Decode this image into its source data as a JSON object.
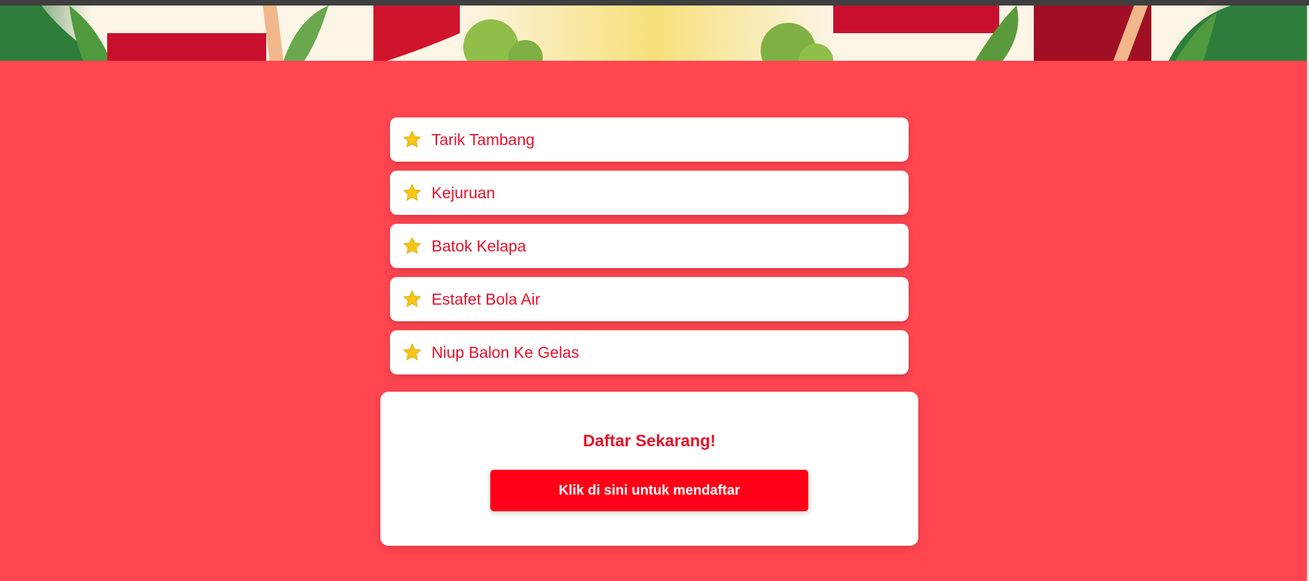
{
  "banner": {
    "description_icon": "decorative-banner"
  },
  "competitions": {
    "icon": "star-icon",
    "items": [
      {
        "label": "Tarik Tambang"
      },
      {
        "label": "Kejuruan"
      },
      {
        "label": "Batok Kelapa"
      },
      {
        "label": "Estafet Bola Air"
      },
      {
        "label": "Niup Balon Ke Gelas"
      }
    ]
  },
  "register": {
    "title": "Daftar Sekarang!",
    "button_label": "Klik di sini untuk mendaftar"
  },
  "colors": {
    "background": "#ff4550",
    "accent": "#e8122a",
    "button": "#ff0018",
    "star": "#f5c518"
  }
}
